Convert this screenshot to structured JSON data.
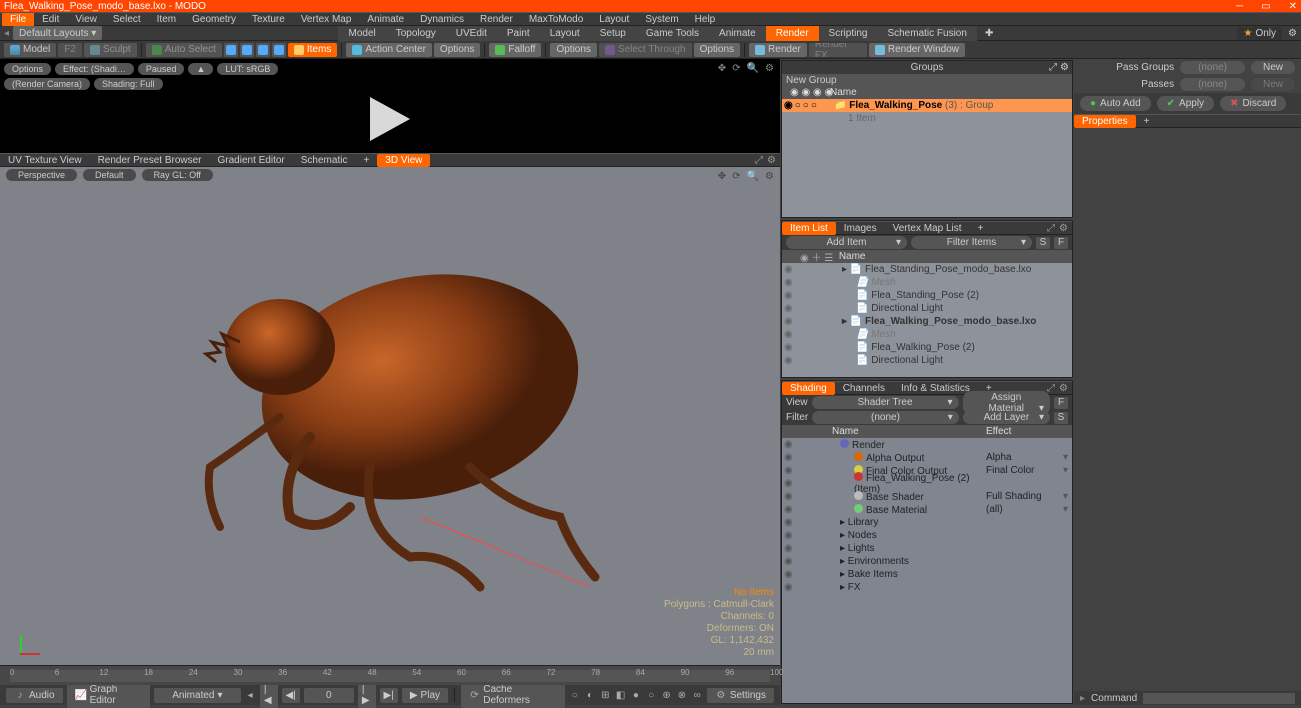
{
  "app": {
    "title": "Flea_Walking_Pose_modo_base.lxo - MODO"
  },
  "winbtns": {
    "min": "─",
    "max": "▭",
    "close": "✕"
  },
  "menu": [
    "File",
    "Edit",
    "View",
    "Select",
    "Item",
    "Geometry",
    "Texture",
    "Vertex Map",
    "Animate",
    "Dynamics",
    "Render",
    "MaxToModo",
    "Layout",
    "System",
    "Help"
  ],
  "menu_active": 0,
  "layout": {
    "default": "Default Layouts ▾",
    "tabs": [
      "Model",
      "Topology",
      "UVEdit",
      "Paint",
      "Layout",
      "Setup",
      "Game Tools",
      "Animate",
      "Render",
      "Scripting",
      "Schematic Fusion"
    ],
    "active": 8,
    "only": "Only"
  },
  "tool2": {
    "model": "Model",
    "f2": "F2",
    "sculpt": "Sculpt",
    "autosel": "Auto Select",
    "items": "Items",
    "action": "Action Center",
    "options": "Options",
    "falloff": "Falloff",
    "options2": "Options",
    "sel": "Select Through",
    "options3": "Options",
    "render": "Render",
    "renderfx": "Render FX",
    "renderwin": "Render Window"
  },
  "preview": {
    "pills": [
      "Options",
      "Effect: (Shadi…",
      "Paused",
      "▲",
      "LUT: sRGB"
    ],
    "pills2": [
      "(Render Camera)",
      "Shading: Full"
    ]
  },
  "vptabs": [
    "3D View",
    "UV Texture View",
    "Render Preset Browser",
    "Gradient Editor",
    "Schematic",
    "+"
  ],
  "vpctrl": [
    "Perspective",
    "Default",
    "Ray GL: Off"
  ],
  "vpstats": {
    "noitems": "No Items",
    "lines": [
      "Polygons : Catmull-Clark",
      "Channels: 0",
      "Deformers: ON",
      "GL: 1,142,432",
      "20 mm"
    ]
  },
  "timeticks": [
    "0",
    "6",
    "12",
    "18",
    "24",
    "30",
    "36",
    "42",
    "48",
    "54",
    "60",
    "66",
    "72",
    "78",
    "84",
    "90",
    "96",
    "100"
  ],
  "bottom": {
    "audio": "Audio",
    "graph": "Graph Editor",
    "anim": "Animated",
    "frame": "0",
    "play": "Play",
    "cache": "Cache Deformers",
    "settings": "Settings"
  },
  "groups": {
    "title": "Groups",
    "new": "New Group",
    "name": "Name",
    "root": "Flea_Walking_Pose",
    "rootmeta": "(3) : Group",
    "count": "1 Item"
  },
  "itemlist": {
    "tabs": [
      "Item List",
      "Images",
      "Vertex Map List",
      "+"
    ],
    "add": "Add Item",
    "filter": "Filter Items",
    "hdr": "Name",
    "rows": [
      {
        "t": "Flea_Standing_Pose_modo_base.lxo",
        "ind": 1,
        "bold": false
      },
      {
        "t": "Mesh",
        "ind": 2,
        "ital": true
      },
      {
        "t": "Flea_Standing_Pose (2)",
        "ind": 2
      },
      {
        "t": "Directional Light",
        "ind": 2
      },
      {
        "t": "Flea_Walking_Pose_modo_base.lxo",
        "ind": 1,
        "bold": true
      },
      {
        "t": "Mesh",
        "ind": 2,
        "ital": true
      },
      {
        "t": "Flea_Walking_Pose (2)",
        "ind": 2
      },
      {
        "t": "Directional Light",
        "ind": 2
      }
    ]
  },
  "shading": {
    "tabs": [
      "Shading",
      "Channels",
      "Info & Statistics",
      "+"
    ],
    "view_l": "View",
    "view": "Shader Tree",
    "assign": "Assign Material",
    "filter_l": "Filter",
    "filter": "(none)",
    "add": "Add Layer",
    "hdr_name": "Name",
    "hdr_eff": "Effect",
    "rows": [
      {
        "n": "Render",
        "e": "",
        "ind": 1,
        "ball": "#66b"
      },
      {
        "n": "Alpha Output",
        "e": "Alpha",
        "ind": 2,
        "ball": "#d60"
      },
      {
        "n": "Final Color Output",
        "e": "Final Color",
        "ind": 2,
        "ball": "#dc4"
      },
      {
        "n": "Flea_Walking_Pose (2) (Item)",
        "e": "",
        "ind": 2,
        "ball": "#c33"
      },
      {
        "n": "Base Shader",
        "e": "Full Shading",
        "ind": 2,
        "ball": "#bbb"
      },
      {
        "n": "Base Material",
        "e": "(all)",
        "ind": 2,
        "ball": "#7c7"
      },
      {
        "n": "Library",
        "e": "",
        "ind": 1
      },
      {
        "n": "Nodes",
        "e": "",
        "ind": 1
      },
      {
        "n": "Lights",
        "e": "",
        "ind": 1
      },
      {
        "n": "Environments",
        "e": "",
        "ind": 1
      },
      {
        "n": "Bake Items",
        "e": "",
        "ind": 1
      },
      {
        "n": "FX",
        "e": "",
        "ind": 1
      }
    ]
  },
  "right": {
    "passgroups": "Pass Groups",
    "passes": "Passes",
    "none": "(none)",
    "new": "New",
    "autoadd": "Auto Add",
    "apply": "Apply",
    "discard": "Discard",
    "props": "Properties",
    "command": "Command"
  }
}
